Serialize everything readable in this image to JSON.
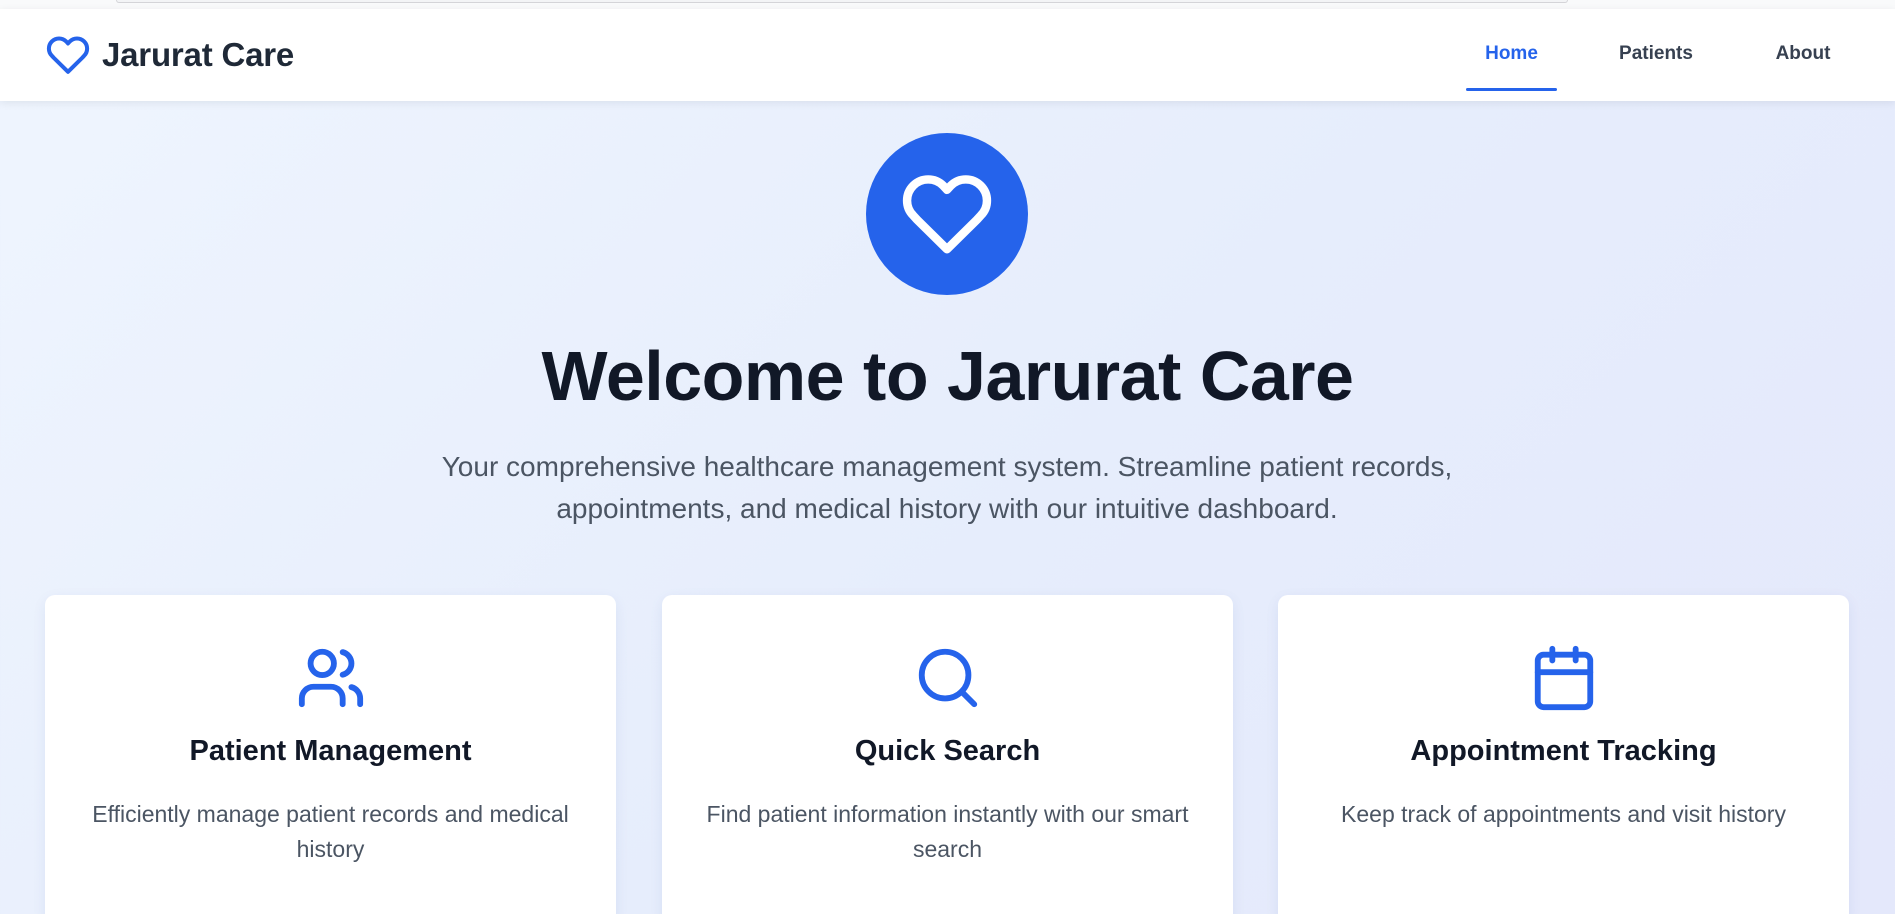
{
  "colors": {
    "accent": "#2563eb",
    "heading": "#111827",
    "body_text": "#4b5563",
    "background": "#eaf0fd"
  },
  "navbar": {
    "brand_icon": "heart-icon",
    "brand_name": "Jarurat Care",
    "links": [
      {
        "label": "Home",
        "active": true
      },
      {
        "label": "Patients",
        "active": false
      },
      {
        "label": "About",
        "active": false
      }
    ]
  },
  "hero": {
    "icon": "heart-icon",
    "title": "Welcome to Jarurat Care",
    "subtitle": "Your comprehensive healthcare management system. Streamline patient records, appointments, and medical history with our intuitive dashboard."
  },
  "features": [
    {
      "icon": "users-icon",
      "title": "Patient Management",
      "description": "Efficiently manage patient records and medical history"
    },
    {
      "icon": "search-icon",
      "title": "Quick Search",
      "description": "Find patient information instantly with our smart search"
    },
    {
      "icon": "calendar-icon",
      "title": "Appointment Tracking",
      "description": "Keep track of appointments and visit history"
    }
  ]
}
